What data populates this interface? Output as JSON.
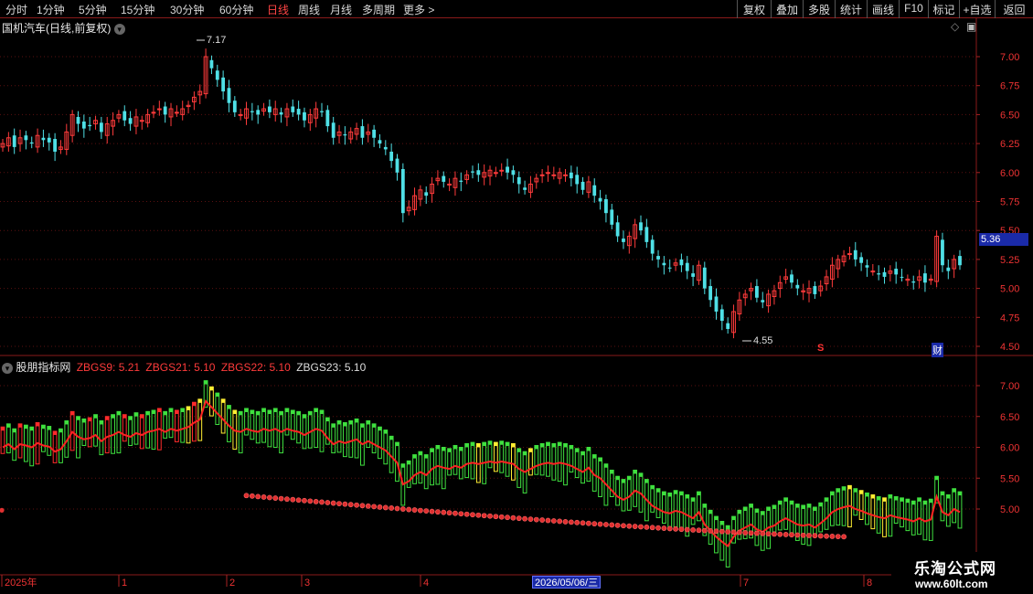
{
  "toolbar": {
    "periods": [
      {
        "label": "分时",
        "active": false
      },
      {
        "label": "1分钟",
        "active": false
      },
      {
        "label": "5分钟",
        "active": false
      },
      {
        "label": "15分钟",
        "active": false
      },
      {
        "label": "30分钟",
        "active": false
      },
      {
        "label": "60分钟",
        "active": false
      },
      {
        "label": "日线",
        "active": true
      },
      {
        "label": "周线",
        "active": false
      },
      {
        "label": "月线",
        "active": false
      },
      {
        "label": "多周期",
        "active": false
      },
      {
        "label": "更多 >",
        "active": false
      }
    ],
    "actions": [
      "复权",
      "叠加",
      "多股",
      "统计",
      "画线",
      "F10",
      "标记",
      "+自选",
      "返回"
    ]
  },
  "main_chart": {
    "title": "国机汽车(日线,前复权)",
    "high_label": "7.17",
    "low_label": "4.55",
    "current_price": "5.36",
    "marker_s": "S",
    "marker_cai": "财",
    "y_ticks": [
      "7.00",
      "6.75",
      "6.50",
      "6.25",
      "6.00",
      "5.75",
      "5.50",
      "5.25",
      "5.00",
      "4.75",
      "4.50"
    ]
  },
  "indicator": {
    "name": "股朋指标网",
    "values": [
      {
        "label": "ZBGS9: 5.21",
        "color": "#ff3b3b"
      },
      {
        "label": "ZBGS21: 5.10",
        "color": "#ff3b3b"
      },
      {
        "label": "ZBGS22: 5.10",
        "color": "#ff3b3b"
      },
      {
        "label": "ZBGS23: 5.10",
        "color": "#dddddd"
      }
    ],
    "y_ticks": [
      "7.00",
      "6.50",
      "6.00",
      "5.50",
      "5.00"
    ]
  },
  "x_axis": {
    "labels": [
      "2025年",
      "1",
      "2",
      "3",
      "4",
      "7",
      "8"
    ],
    "cursor_date": "2026/05/06/三"
  },
  "watermark": {
    "line1": "乐淘公式网",
    "line2": "www.60lt.com"
  },
  "chart_data": {
    "type": "candlestick",
    "title": "国机汽车(日线,前复权)",
    "price_high": 7.17,
    "price_low": 4.55,
    "last_price": 5.36,
    "ylim": [
      4.45,
      7.3
    ],
    "colors": {
      "up": "#ff3b3b",
      "down": "#4fe0e6",
      "grid": "#5a1010"
    },
    "closes": [
      6.25,
      6.3,
      6.22,
      6.3,
      6.28,
      6.25,
      6.32,
      6.28,
      6.26,
      6.18,
      6.22,
      6.35,
      6.5,
      6.42,
      6.38,
      6.4,
      6.45,
      6.35,
      6.42,
      6.45,
      6.5,
      6.45,
      6.42,
      6.48,
      6.45,
      6.5,
      6.52,
      6.55,
      6.5,
      6.55,
      6.52,
      6.55,
      6.58,
      6.65,
      6.7,
      7.0,
      6.9,
      6.8,
      6.7,
      6.6,
      6.52,
      6.5,
      6.55,
      6.52,
      6.5,
      6.55,
      6.52,
      6.55,
      6.5,
      6.55,
      6.52,
      6.5,
      6.45,
      6.5,
      6.55,
      6.52,
      6.4,
      6.3,
      6.35,
      6.32,
      6.35,
      6.38,
      6.3,
      6.35,
      6.3,
      6.25,
      6.2,
      6.1,
      6.0,
      5.65,
      5.7,
      5.8,
      5.85,
      5.8,
      5.9,
      5.95,
      5.92,
      5.9,
      5.95,
      5.92,
      5.98,
      6.0,
      5.98,
      6.0,
      6.02,
      6.0,
      6.02,
      6.0,
      5.98,
      5.9,
      5.85,
      5.9,
      5.95,
      5.98,
      6.0,
      5.98,
      6.0,
      5.98,
      5.95,
      5.9,
      5.85,
      5.92,
      5.8,
      5.75,
      5.65,
      5.55,
      5.45,
      5.4,
      5.45,
      5.55,
      5.5,
      5.4,
      5.3,
      5.25,
      5.2,
      5.18,
      5.22,
      5.2,
      5.15,
      5.1,
      5.2,
      5.0,
      4.9,
      4.8,
      4.72,
      4.65,
      4.8,
      4.9,
      4.95,
      5.0,
      4.92,
      4.88,
      4.95,
      4.98,
      5.05,
      5.1,
      5.05,
      5.0,
      4.98,
      5.0,
      4.95,
      5.02,
      5.1,
      5.2,
      5.25,
      5.28,
      5.3,
      5.25,
      5.22,
      5.18,
      5.15,
      5.12,
      5.1,
      5.15,
      5.12,
      5.1,
      5.08,
      5.05,
      5.1,
      5.05,
      5.08,
      5.45,
      5.2,
      5.15,
      5.25,
      5.2
    ],
    "indicator_line_ZBGS21": 5.1,
    "indicator_ZBGS9": 5.21,
    "indicator_ZBGS22": 5.1,
    "indicator_ZBGS23": 5.1
  }
}
